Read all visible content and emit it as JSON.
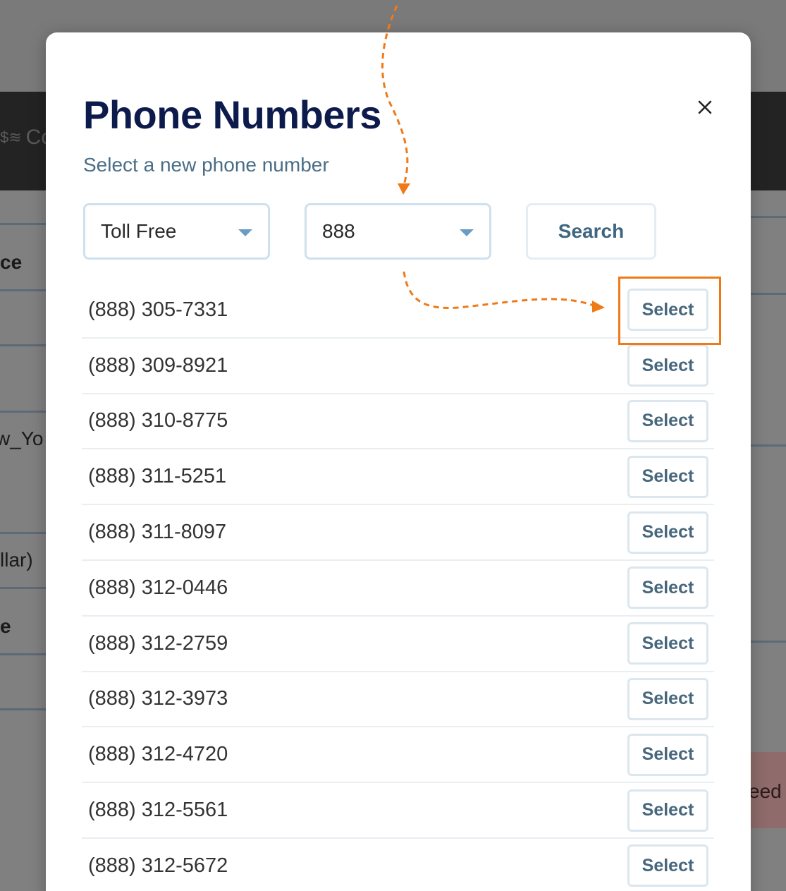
{
  "background": {
    "header_text": "Co",
    "fragments": [
      "ce",
      "w_Yo",
      "llar)",
      "e",
      "eed"
    ]
  },
  "modal": {
    "title": "Phone Numbers",
    "subtitle": "Select a new phone number",
    "close_icon": "close-icon",
    "type_select": {
      "value": "Toll Free"
    },
    "area_code_select": {
      "value": "888"
    },
    "search_label": "Search",
    "select_label": "Select",
    "numbers": [
      "(888) 305-7331",
      "(888) 309-8921",
      "(888) 310-8775",
      "(888) 311-5251",
      "(888) 311-8097",
      "(888) 312-0446",
      "(888) 312-2759",
      "(888) 312-3973",
      "(888) 312-4720",
      "(888) 312-5561",
      "(888) 312-5672"
    ]
  },
  "annotation": {
    "highlight_color": "#ef7a18"
  }
}
